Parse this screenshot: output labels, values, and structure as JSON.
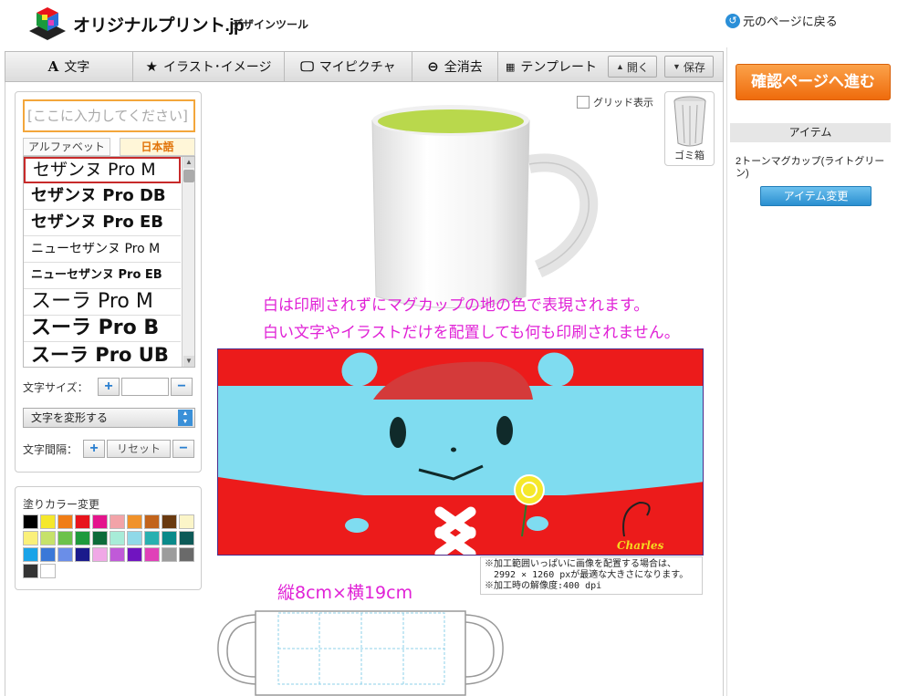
{
  "header": {
    "logo_text": "オリジナルプリント.jp",
    "logo_sub": "デザインツール",
    "back_link": "元のページに戻る"
  },
  "toolbar": {
    "text": "文字",
    "illust": "イラスト･イメージ",
    "mypicture": "マイピクチャ",
    "clear_all": "全消去",
    "template": "テンプレート",
    "open": "開く",
    "save": "保存"
  },
  "text_panel": {
    "input_placeholder": "[ここに入力してください]",
    "tab_alphabet": "アルファベット",
    "tab_japanese": "日本語",
    "fonts": [
      {
        "label": "セザンヌ Pro M",
        "weight": "normal",
        "size": "19px"
      },
      {
        "label": "セザンヌ Pro DB",
        "weight": "600",
        "size": "18px"
      },
      {
        "label": "セザンヌ Pro EB",
        "weight": "bold",
        "size": "18px"
      },
      {
        "label": "ニューセザンヌ Pro M",
        "weight": "normal",
        "size": "14px"
      },
      {
        "label": "ニューセザンヌ Pro EB",
        "weight": "bold",
        "size": "13px"
      },
      {
        "label": "スーラ Pro M",
        "weight": "normal",
        "size": "22px"
      },
      {
        "label": "スーラ Pro B",
        "weight": "bold",
        "size": "22px"
      },
      {
        "label": "スーラ Pro UB",
        "weight": "900",
        "size": "21px"
      }
    ],
    "size_label": "文字サイズ：",
    "transform_label": "文字を変形する",
    "spacing_label": "文字間隔：",
    "reset_label": "リセット"
  },
  "color_panel": {
    "title": "塗りカラー変更",
    "swatches": [
      "#000000",
      "#f5e82b",
      "#f07d16",
      "#e8141c",
      "#e4148c",
      "#f2a3a8",
      "#f0922a",
      "#c2641c",
      "#6a3a10",
      "#fbf5c8",
      "#faf07a",
      "#c6e26a",
      "#6cc24a",
      "#1e9a3c",
      "#0d6b3a",
      "#a8ecd8",
      "#90d9e8",
      "#28b0b0",
      "#0a8a8a",
      "#0d5a58",
      "#1aa3e8",
      "#3a78d8",
      "#6a8ee8",
      "#1a1a8c",
      "#f0a8e6",
      "#c05ad8",
      "#7014c0",
      "#e040b8",
      "#9c9c9c",
      "#6a6a6a",
      "#333333",
      "#ffffff"
    ]
  },
  "canvas": {
    "grid_label": "グリッド表示",
    "trash_label": "ゴミ箱",
    "notice_line1": "白は印刷されずにマグカップの地の色で表現されます。",
    "notice_line2": "白い文字やイラストだけを配置しても何も印刷されません。",
    "signature": "Charles",
    "info_line1": "※加工範囲いっぱいに画像を配置する場合は、",
    "info_line2": "　2992 × 1260 pxが最適な大きさになります。",
    "info_line3": "※加工時の解像度:400 dpi",
    "dimensions": "縦8cm×横19cm",
    "mug_inner_color": "#b9d84c"
  },
  "sidebar": {
    "confirm_button": "確認ページへ進む",
    "item_header": "アイテム",
    "item_name": "2トーンマグカップ(ライトグリーン)",
    "item_change": "アイテム変更"
  }
}
